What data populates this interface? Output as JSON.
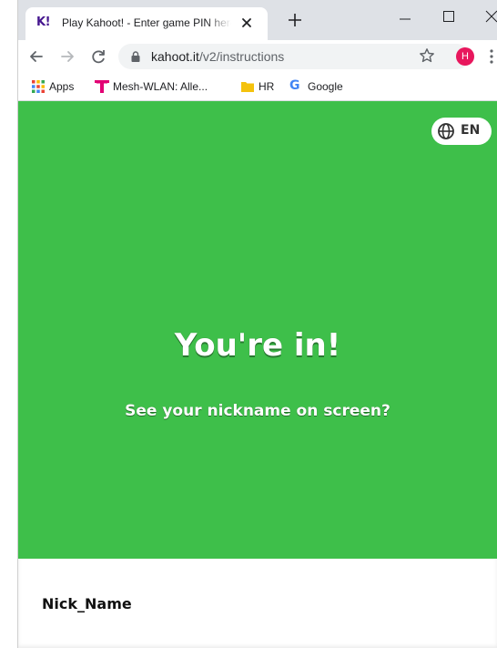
{
  "browser": {
    "tab": {
      "favicon_text": "K!",
      "title": "Play Kahoot! - Enter game PIN here"
    },
    "url": {
      "host": "kahoot.it",
      "path": "/v2/instructions"
    },
    "profile_initial": "H",
    "bookmarks": [
      {
        "label": "Apps",
        "icon": "apps-grid-icon"
      },
      {
        "label": "Mesh-WLAN: Alle...",
        "icon": "telekom-icon"
      },
      {
        "label": "HR",
        "icon": "folder-icon"
      },
      {
        "label": "Google",
        "icon": "google-icon"
      }
    ]
  },
  "page": {
    "language": "EN",
    "title": "You're in!",
    "subtitle": "See your nickname on screen?",
    "nickname": "Nick_Name"
  },
  "colors": {
    "hero_bg": "#3ebf4a",
    "kahoot_purple": "#46178f",
    "avatar_bg": "#e8175d",
    "tab_strip_bg": "#dee1e6"
  }
}
